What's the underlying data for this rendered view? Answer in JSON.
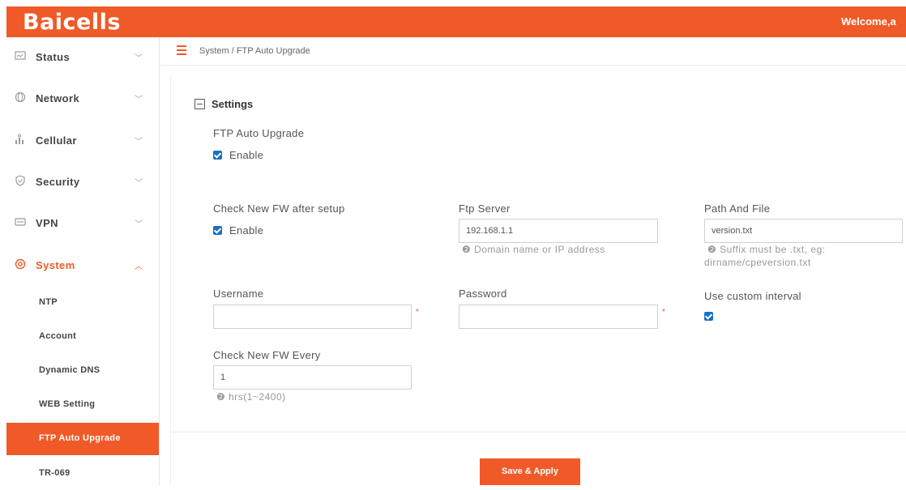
{
  "header": {
    "logo": "Baicells",
    "welcome": "Welcome,a"
  },
  "sidebar": {
    "items": [
      {
        "label": "Status",
        "icon": "monitor-icon"
      },
      {
        "label": "Network",
        "icon": "globe-icon"
      },
      {
        "label": "Cellular",
        "icon": "tower-icon"
      },
      {
        "label": "Security",
        "icon": "shield-icon"
      },
      {
        "label": "VPN",
        "icon": "vpn-icon"
      },
      {
        "label": "System",
        "icon": "gear-icon"
      }
    ],
    "system_children": [
      {
        "label": "NTP"
      },
      {
        "label": "Account"
      },
      {
        "label": "Dynamic DNS"
      },
      {
        "label": "WEB Setting"
      },
      {
        "label": "FTP Auto Upgrade"
      },
      {
        "label": "TR-069"
      }
    ]
  },
  "breadcrumb": "System / FTP Auto Upgrade",
  "settings": {
    "title": "Settings",
    "ftp_auto_upgrade": {
      "label": "FTP Auto Upgrade",
      "checkbox_label": "Enable",
      "checked": true
    },
    "check_after_setup": {
      "label": "Check New FW after setup",
      "checkbox_label": "Enable",
      "checked": true
    },
    "ftp_server": {
      "label": "Ftp Server",
      "value": "192.168.1.1",
      "hint": "Domain name or IP address"
    },
    "path_and_file": {
      "label": "Path And File",
      "value": "version.txt",
      "hint_line1": "Suffix must be .txt, eg:",
      "hint_line2": "dirname/cpeversion.txt"
    },
    "username": {
      "label": "Username",
      "value": "",
      "required_mark": "*"
    },
    "password": {
      "label": "Password",
      "value": "",
      "required_mark": "*"
    },
    "custom_interval": {
      "label": "Use custom interval",
      "checked": true
    },
    "check_every": {
      "label": "Check New FW Every",
      "value": "1",
      "hint": "hrs(1~2400)"
    }
  },
  "actions": {
    "save_label": "Save & Apply"
  },
  "colors": {
    "brand": "#f05a28",
    "checkbox": "#1c6fc4"
  }
}
